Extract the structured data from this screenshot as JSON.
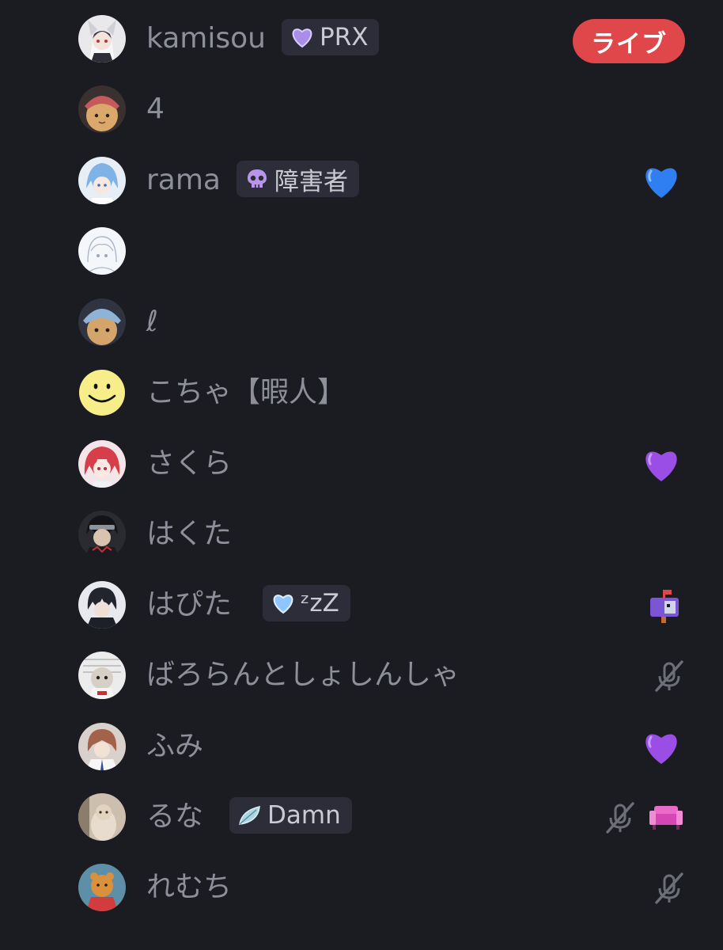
{
  "members": [
    {
      "name": "kamisou",
      "tag": {
        "icon": "purple-heart-icon",
        "text": "PRX"
      },
      "live_label": "ライブ"
    },
    {
      "name": "4"
    },
    {
      "name": "rama",
      "tag": {
        "icon": "skull-icon",
        "text": "障害者"
      },
      "status_icons": [
        "blue-heart-icon"
      ]
    },
    {
      "name": ""
    },
    {
      "name": "ℓ"
    },
    {
      "name": "こちゃ【暇人】"
    },
    {
      "name": "さくら",
      "status_icons": [
        "purple-heart-icon"
      ]
    },
    {
      "name": "はくた"
    },
    {
      "name": "はぴた",
      "tag": {
        "icon": "light-blue-heart-icon",
        "text": "ᶻzZ"
      },
      "status_icons": [
        "mailbox-icon"
      ]
    },
    {
      "name": "ばろらんとしょしんしゃ",
      "status_icons": [
        "muted-mic-icon"
      ]
    },
    {
      "name": "ふみ",
      "status_icons": [
        "purple-heart-icon"
      ]
    },
    {
      "name": "るな",
      "tag": {
        "icon": "feather-icon",
        "text": "Damn"
      },
      "status_icons": [
        "muted-mic-icon",
        "pink-sofa-icon"
      ]
    },
    {
      "name": "れむち",
      "status_icons": [
        "muted-mic-icon"
      ]
    }
  ],
  "colors": {
    "background": "#1b1b22",
    "name_text": "#8d8f99",
    "tag_background": "#2c2d38",
    "live_badge": "#e0474a"
  }
}
